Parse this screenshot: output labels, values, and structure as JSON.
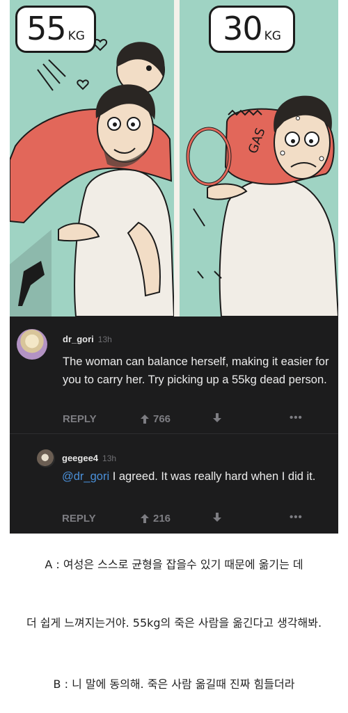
{
  "comic": {
    "left_weight": "55",
    "left_unit": "KG",
    "right_weight": "30",
    "right_unit": "KG",
    "tank_label": "GAS"
  },
  "comments": [
    {
      "username": "dr_gori",
      "time": "13h",
      "text": "The woman can balance herself, making it easier for you to carry her. Try picking up a 55kg dead person.",
      "reply_label": "REPLY",
      "upvotes": "766",
      "more_label": "•••"
    },
    {
      "username": "geegee4",
      "time": "13h",
      "mention": "@dr_gori",
      "text": " I agreed. It was really hard when I did it.",
      "reply_label": "REPLY",
      "upvotes": "216",
      "more_label": "•••"
    }
  ],
  "caption": {
    "line_a": "A : 여성은 스스로 균형을 잡을수 있기 때문에 옮기는 데",
    "line_middle": "더 쉽게 느껴지는거야. 55kg의 죽은 사람을 옮긴다고 생각해봐.",
    "line_b": "B : 니 말에 동의해. 죽은 사람 옮길때 진짜 힘들더라"
  },
  "colors": {
    "comic_background": "#9fd3c3",
    "comment_background": "#1c1c1d",
    "mention": "#4a90d9",
    "muted": "#7d7d82"
  }
}
